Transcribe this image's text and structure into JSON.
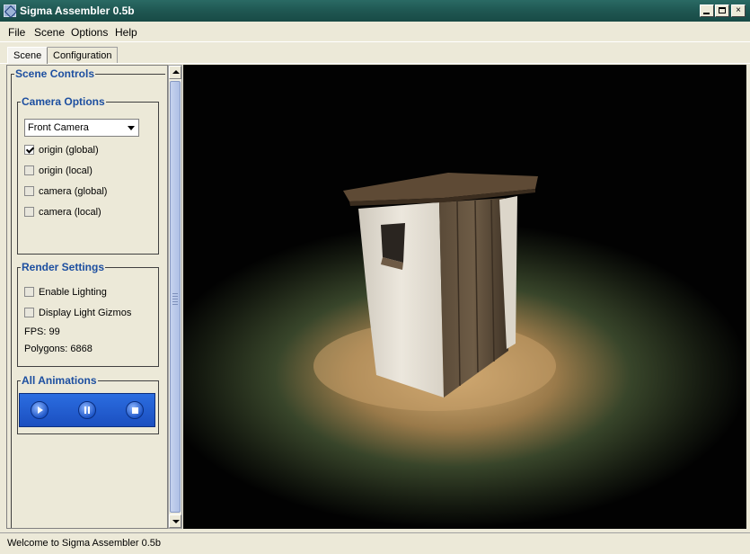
{
  "window": {
    "title": "Sigma Assembler 0.5b",
    "controls": {
      "minimize": "minimize",
      "maximize": "maximize",
      "close": "×"
    }
  },
  "menu": [
    "File",
    "Scene",
    "Options",
    "Help"
  ],
  "tabs": [
    "Scene",
    "Configuration"
  ],
  "panel": {
    "scene_controls_title": "Scene Controls",
    "camera_options": {
      "title": "Camera Options",
      "selected_camera": "Front Camera",
      "checkboxes": [
        {
          "label": "origin (global)",
          "checked": true
        },
        {
          "label": "origin (local)",
          "checked": false
        },
        {
          "label": "camera (global)",
          "checked": false
        },
        {
          "label": "camera (local)",
          "checked": false
        }
      ]
    },
    "render_settings": {
      "title": "Render Settings",
      "checkboxes": [
        {
          "label": "Enable Lighting",
          "checked": false
        },
        {
          "label": "Display Light Gizmos",
          "checked": false
        }
      ],
      "fps": "FPS: 99",
      "polygons": "Polygons: 6868"
    },
    "all_animations": {
      "title": "All Animations",
      "buttons": [
        "play-icon",
        "pause-icon",
        "stop-icon"
      ]
    }
  },
  "status": "Welcome to Sigma Assembler 0.5b",
  "colors": {
    "titlebar": "#1f5752",
    "group_title": "#1d4fa0",
    "animation_bar": "#2b6de0"
  }
}
